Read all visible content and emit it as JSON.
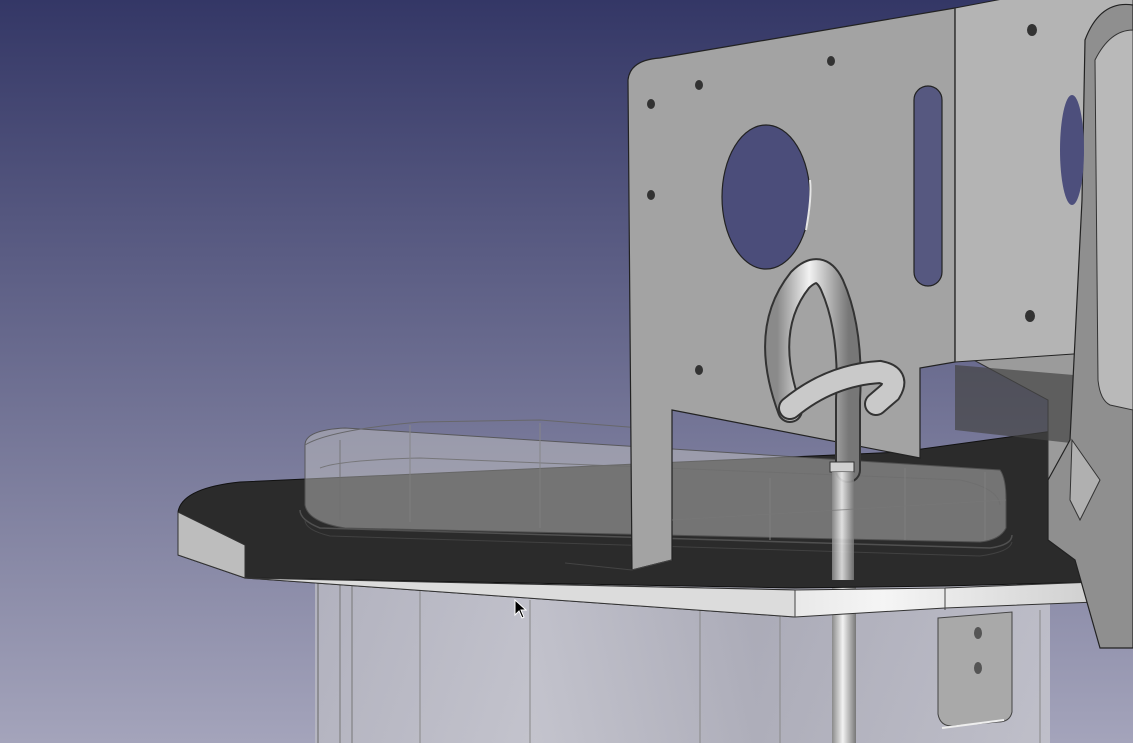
{
  "viewport": {
    "background_top": "#343766",
    "background_bottom": "#a4a4bb",
    "cursor_icon": "arrow-cursor-icon"
  },
  "model": {
    "plate_dark": "#2b2b2b",
    "plate_edge": "#d6d6d6",
    "bracket_face": "#9a9a9a",
    "bracket_light": "#b9b9b9",
    "transparent_part": "#c8c8c8"
  }
}
